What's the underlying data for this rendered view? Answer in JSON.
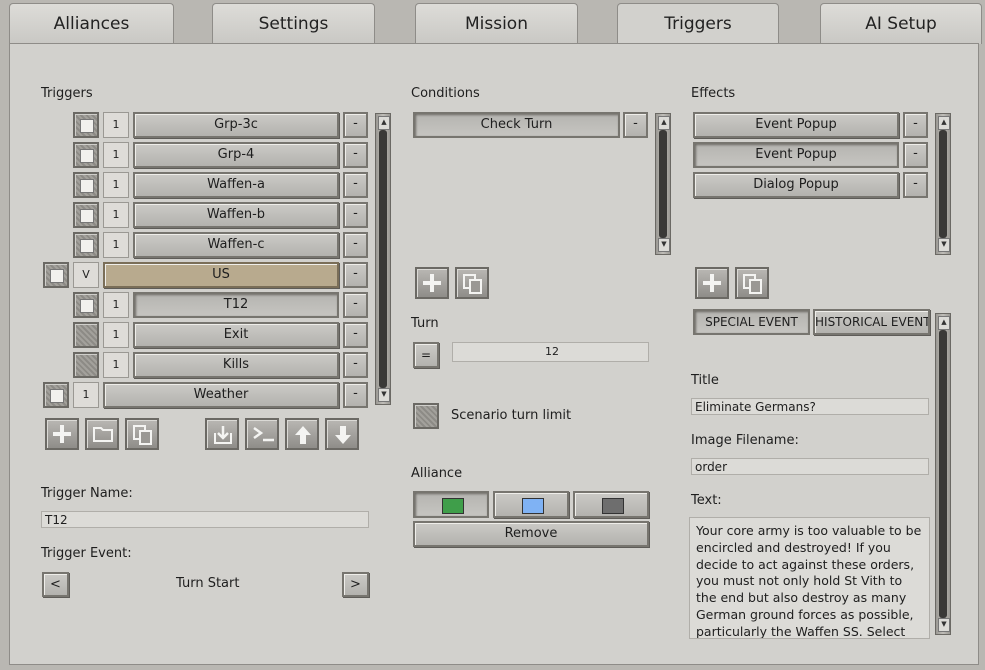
{
  "tabs": [
    {
      "label": "Alliances"
    },
    {
      "label": "Settings"
    },
    {
      "label": "Mission"
    },
    {
      "label": "Triggers"
    },
    {
      "label": "AI Setup"
    }
  ],
  "active_tab": "Triggers",
  "triggers": {
    "title": "Triggers",
    "rows": [
      {
        "num": "1",
        "name": "Grp-3c"
      },
      {
        "num": "1",
        "name": "Grp-4"
      },
      {
        "num": "1",
        "name": "Waffen-a"
      },
      {
        "num": "1",
        "name": "Waffen-b"
      },
      {
        "num": "1",
        "name": "Waffen-c"
      },
      {
        "num": "V",
        "name": "US"
      },
      {
        "num": "1",
        "name": "T12"
      },
      {
        "num": "1",
        "name": "Exit"
      },
      {
        "num": "1",
        "name": "Kills"
      },
      {
        "num": "1",
        "name": "Weather"
      }
    ],
    "remove_label": "-",
    "name_label": "Trigger Name:",
    "name_value": "T12",
    "event_label": "Trigger Event:",
    "event_value": "Turn Start",
    "prev": "<",
    "next": ">"
  },
  "conditions": {
    "title": "Conditions",
    "items": [
      {
        "label": "Check Turn"
      }
    ],
    "turn_label": "Turn",
    "turn_operator": "=",
    "turn_value": "12",
    "scenario_limit_label": "Scenario turn limit",
    "alliance_label": "Alliance",
    "alliance_colors": [
      "#3f9e4a",
      "#7fb2f4",
      "#6e6e6e"
    ],
    "remove_label": "Remove"
  },
  "effects": {
    "title": "Effects",
    "items": [
      {
        "label": "Event Popup"
      },
      {
        "label": "Event Popup"
      },
      {
        "label": "Dialog Popup"
      }
    ],
    "special_event": "SPECIAL EVENT",
    "historical_event": "HISTORICAL EVENT",
    "title_label": "Title",
    "title_value": "Eliminate Germans?",
    "image_label": "Image Filename:",
    "image_value": "order",
    "text_label": "Text:",
    "text_value": "Your core army is too valuable to be encircled and destroyed! If you decide to act against these orders, you must not only hold St Vith to the end but also destroy as many German ground forces as possible, particularly the Waffen SS. Select which order you"
  }
}
